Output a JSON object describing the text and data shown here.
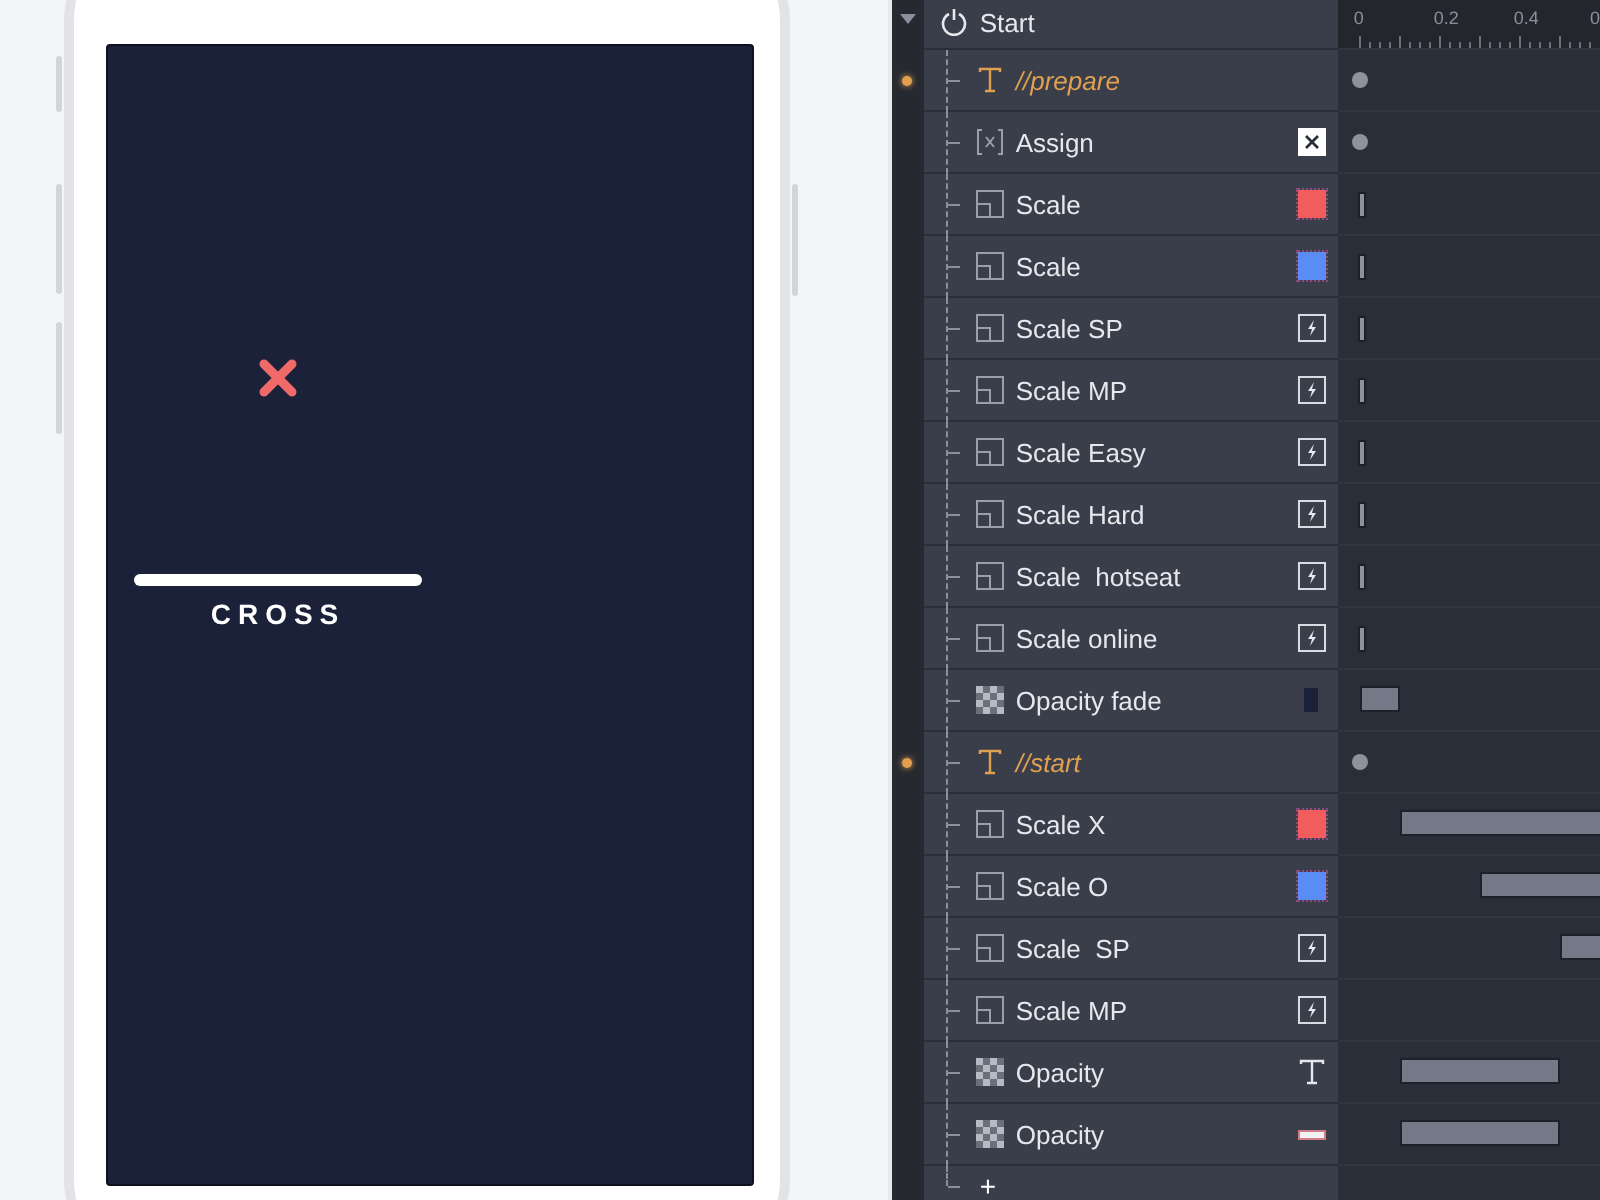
{
  "preview": {
    "caption": "CROSS"
  },
  "timeline": {
    "ruler": [
      "0",
      "0.2",
      "0.4",
      "0"
    ]
  },
  "outline": {
    "root": {
      "label": "Start",
      "expanded": true
    },
    "rows": [
      {
        "label": "//prepare",
        "kind": "comment",
        "badge": {
          "kind": "none"
        },
        "track": {
          "kind": "keyframe"
        }
      },
      {
        "label": "Assign",
        "kind": "assign",
        "badge": {
          "kind": "variable"
        },
        "track": {
          "kind": "keyframe"
        }
      },
      {
        "label": "Scale",
        "kind": "scale",
        "badge": {
          "kind": "color",
          "color": "#f25c5c"
        },
        "track": {
          "kind": "tick"
        }
      },
      {
        "label": "Scale",
        "kind": "scale",
        "badge": {
          "kind": "color",
          "color": "#5b8cf5"
        },
        "track": {
          "kind": "tick"
        }
      },
      {
        "label": "Scale SP",
        "kind": "scale",
        "badge": {
          "kind": "bolt"
        },
        "track": {
          "kind": "tick"
        }
      },
      {
        "label": "Scale MP",
        "kind": "scale",
        "badge": {
          "kind": "bolt"
        },
        "track": {
          "kind": "tick"
        }
      },
      {
        "label": "Scale Easy",
        "kind": "scale",
        "badge": {
          "kind": "bolt"
        },
        "track": {
          "kind": "tick"
        }
      },
      {
        "label": "Scale Hard",
        "kind": "scale",
        "badge": {
          "kind": "bolt"
        },
        "track": {
          "kind": "tick"
        }
      },
      {
        "label": "Scale  hotseat",
        "kind": "scale",
        "badge": {
          "kind": "bolt"
        },
        "track": {
          "kind": "tick"
        }
      },
      {
        "label": "Scale online",
        "kind": "scale",
        "badge": {
          "kind": "bolt"
        },
        "track": {
          "kind": "tick"
        }
      },
      {
        "label": "Opacity fade",
        "kind": "opacity",
        "badge": {
          "kind": "swatch"
        },
        "track": {
          "kind": "bar"
        }
      },
      {
        "label": "//start",
        "kind": "comment",
        "badge": {
          "kind": "none"
        },
        "track": {
          "kind": "keyframe"
        }
      },
      {
        "label": "Scale X",
        "kind": "scale",
        "badge": {
          "kind": "color",
          "color": "#f25c5c"
        },
        "track": {
          "kind": "bar"
        }
      },
      {
        "label": "Scale O",
        "kind": "scale",
        "badge": {
          "kind": "color",
          "color": "#5b8cf5"
        },
        "track": {
          "kind": "bar"
        }
      },
      {
        "label": "Scale  SP",
        "kind": "scale",
        "badge": {
          "kind": "bolt"
        },
        "track": {
          "kind": "bar"
        }
      },
      {
        "label": "Scale MP",
        "kind": "scale",
        "badge": {
          "kind": "bolt"
        },
        "track": {
          "kind": "none"
        }
      },
      {
        "label": "Opacity",
        "kind": "opacity",
        "badge": {
          "kind": "text"
        },
        "track": {
          "kind": "bar"
        }
      },
      {
        "label": "Opacity",
        "kind": "opacity",
        "badge": {
          "kind": "line"
        },
        "track": {
          "kind": "bar"
        }
      }
    ],
    "add": "+"
  }
}
